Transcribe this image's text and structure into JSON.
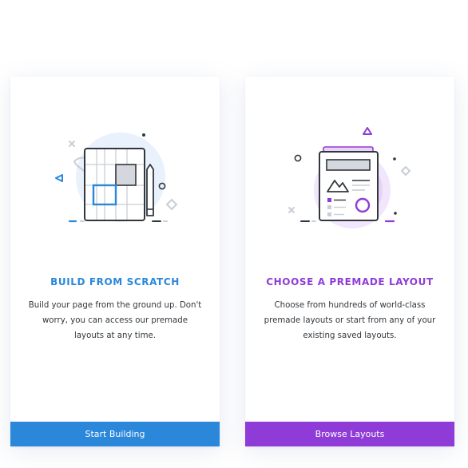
{
  "colors": {
    "blue_accent": "#2b87da",
    "purple_accent": "#8f3bd7",
    "text": "#32373c"
  },
  "cards": [
    {
      "id": "build-from-scratch",
      "title": "BUILD FROM SCRATCH",
      "description": "Build your page from the ground up. Don't worry, you can access our premade layouts at any time.",
      "button_label": "Start Building",
      "illustration": "wireframe-grid-icon"
    },
    {
      "id": "choose-premade-layout",
      "title": "CHOOSE A PREMADE LAYOUT",
      "description": "Choose from hundreds of world-class premade layouts or start from any of your existing saved layouts.",
      "button_label": "Browse Layouts",
      "illustration": "layout-template-icon"
    }
  ]
}
